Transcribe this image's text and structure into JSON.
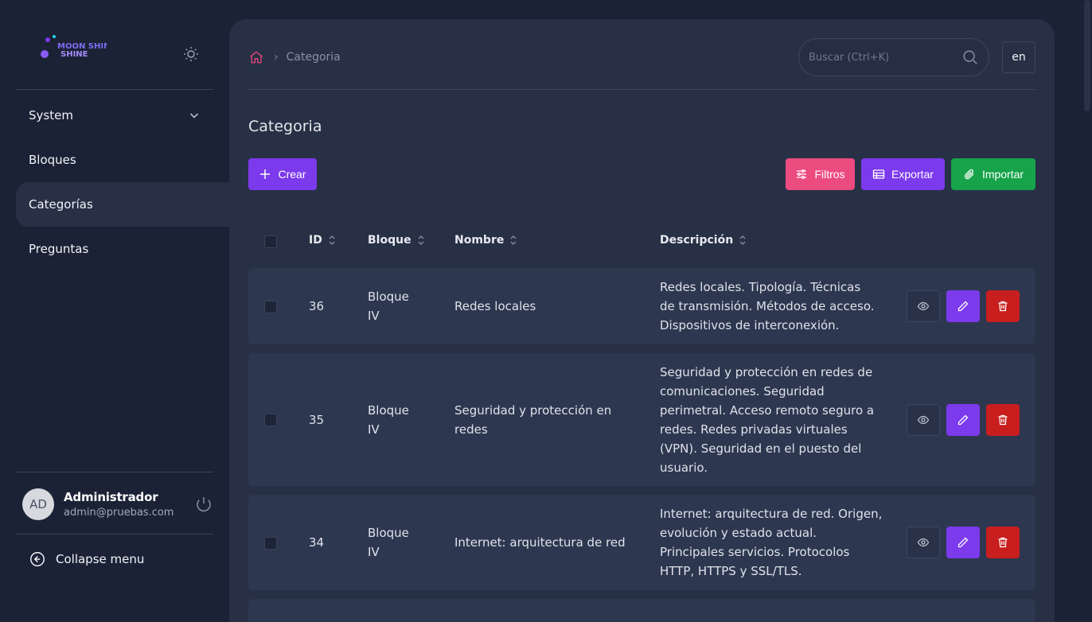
{
  "app": {
    "brand": "MOON SHINE"
  },
  "sidebar": {
    "items": [
      {
        "label": "System",
        "expandable": true
      },
      {
        "label": "Bloques"
      },
      {
        "label": "Categorías",
        "active": true
      },
      {
        "label": "Preguntas"
      }
    ],
    "user": {
      "initials": "AD",
      "name": "Administrador",
      "email": "admin@pruebas.com"
    },
    "collapse_label": "Collapse menu"
  },
  "header": {
    "breadcrumb": "Categoria",
    "search_placeholder": "Buscar (Ctrl+K)",
    "lang": "en"
  },
  "page": {
    "title": "Categoria",
    "create_label": "Crear",
    "filters_label": "Filtros",
    "export_label": "Exportar",
    "import_label": "Importar"
  },
  "table": {
    "columns": [
      "ID",
      "Bloque",
      "Nombre",
      "Descripción"
    ],
    "rows": [
      {
        "id": "36",
        "bloque": [
          "Bloque",
          "IV"
        ],
        "nombre": [
          "Redes locales"
        ],
        "descripcion": [
          "Redes locales. Tipología. Técnicas",
          "de transmisión. Métodos de acceso.",
          "Dispositivos de interconexión."
        ]
      },
      {
        "id": "35",
        "bloque": [
          "Bloque",
          "IV"
        ],
        "nombre": [
          "Seguridad y protección en",
          "redes"
        ],
        "descripcion": [
          "Seguridad y protección en redes de",
          "comunicaciones. Seguridad",
          "perimetral. Acceso remoto seguro a",
          "redes. Redes privadas virtuales",
          "(VPN). Seguridad en el puesto del",
          "usuario."
        ]
      },
      {
        "id": "34",
        "bloque": [
          "Bloque",
          "IV"
        ],
        "nombre": [
          "Internet: arquitectura de red"
        ],
        "descripcion": [
          "Internet: arquitectura de red. Origen,",
          "evolución y estado actual.",
          "Principales servicios. Protocolos",
          "HTTP, HTTPS y SSL/TLS."
        ]
      }
    ]
  },
  "colors": {
    "background": "#1b2236",
    "panel": "#283046",
    "row": "#2e3750",
    "primary": "#7c3aed",
    "pink": "#ec4b80",
    "green": "#16a34a",
    "danger": "#c81e1e",
    "home_icon": "#e8457a"
  },
  "icons": [
    "moonshine-logo",
    "sun-icon",
    "chevron-down-icon",
    "power-icon",
    "arrow-left-circle-icon",
    "home-icon",
    "search-icon",
    "plus-icon",
    "sliders-icon",
    "table-icon",
    "paperclip-icon",
    "sort-icon",
    "eye-icon",
    "pencil-icon",
    "trash-icon"
  ]
}
